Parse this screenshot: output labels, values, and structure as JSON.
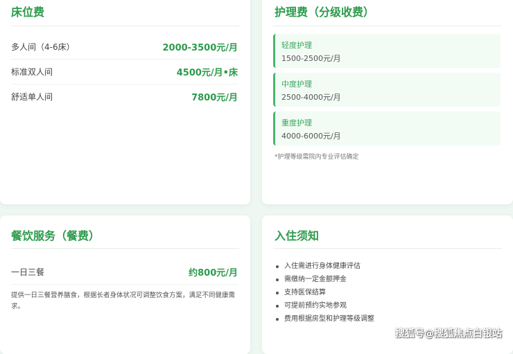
{
  "bed": {
    "title": "床位费",
    "rows": [
      {
        "label": "多人间（4-6床）",
        "price": "2000-3500元/月"
      },
      {
        "label": "标准双人间",
        "price": "4500元/月•床"
      },
      {
        "label": "舒适单人间",
        "price": "7800元/月"
      }
    ]
  },
  "nursing": {
    "title": "护理费（分级收费）",
    "levels": [
      {
        "name": "轻度护理",
        "price": "1500-2500元/月"
      },
      {
        "name": "中度护理",
        "price": "2500-4000元/月"
      },
      {
        "name": "重度护理",
        "price": "4000-6000元/月"
      }
    ],
    "note": "*护理等级需院内专业评估确定"
  },
  "meal": {
    "title": "餐饮服务（餐费）",
    "row": {
      "label": "一日三餐",
      "price": "约800元/月"
    },
    "description": "提供一日三餐营养膳食，根据长者身体状况可调整饮食方案，满足不同健康需求。"
  },
  "notice": {
    "title": "入住须知",
    "items": [
      "入住需进行身体健康评估",
      "需缴纳一定金额押金",
      "支持医保结算",
      "可提前预约实地参观",
      "费用根据房型和护理等级调整"
    ]
  },
  "watermark": "搜狐号@搜狐焦点白银站",
  "colors": {
    "accent": "#2c9b4c",
    "background": "#eef7f1",
    "level_bg": "#f3fbf5"
  }
}
